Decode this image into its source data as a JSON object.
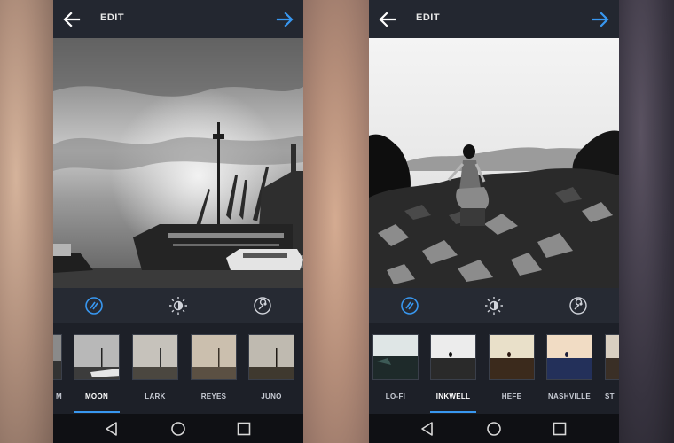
{
  "colors": {
    "accent": "#3897f0",
    "toolbar_bg": "#232730",
    "panel_bg": "#262a33",
    "strip_bg": "#1d2028",
    "nav_bg": "#0f1014"
  },
  "left_phone": {
    "header": {
      "back_icon": "back-arrow-icon",
      "title": "EDIT",
      "next_icon": "next-arrow-icon"
    },
    "tools": [
      "filter-icon",
      "lux-brightness-icon",
      "wrench-icon"
    ],
    "filters": [
      {
        "label": "M",
        "selected": false
      },
      {
        "label": "MOON",
        "selected": true
      },
      {
        "label": "LARK",
        "selected": false
      },
      {
        "label": "REYES",
        "selected": false
      },
      {
        "label": "JUNO",
        "selected": false
      }
    ],
    "nav": [
      "back-triangle-icon",
      "home-circle-icon",
      "recents-square-icon"
    ]
  },
  "right_phone": {
    "header": {
      "back_icon": "back-arrow-icon",
      "title": "EDIT",
      "next_icon": "next-arrow-icon"
    },
    "tools": [
      "filter-icon",
      "lux-brightness-icon",
      "wrench-icon"
    ],
    "filters": [
      {
        "label": "LO-FI",
        "selected": false
      },
      {
        "label": "INKWELL",
        "selected": true
      },
      {
        "label": "HEFE",
        "selected": false
      },
      {
        "label": "NASHVILLE",
        "selected": false
      },
      {
        "label": "ST",
        "selected": false
      }
    ],
    "nav": [
      "back-triangle-icon",
      "home-circle-icon",
      "recents-square-icon"
    ]
  }
}
